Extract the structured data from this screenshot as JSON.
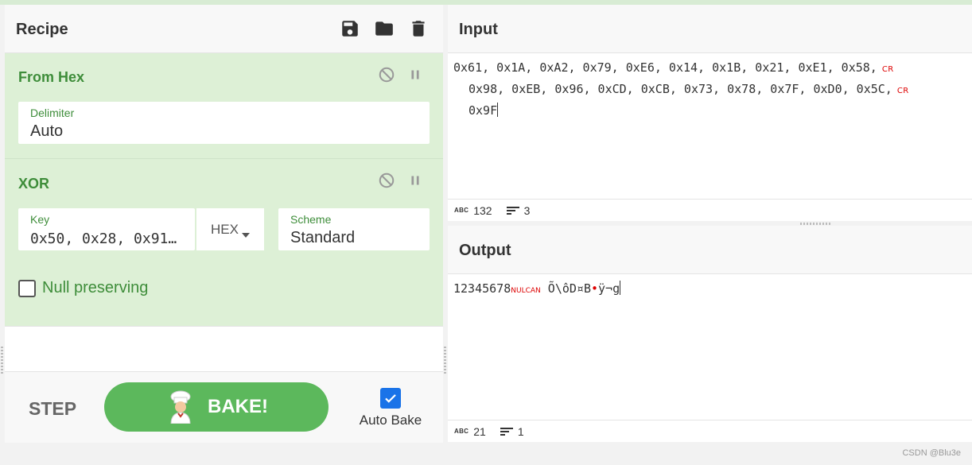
{
  "recipe": {
    "title": "Recipe",
    "icons": [
      "save-icon",
      "folder-icon",
      "trash-icon"
    ],
    "operations": [
      {
        "name": "From Hex",
        "fields": [
          {
            "label": "Delimiter",
            "value": "Auto"
          }
        ]
      },
      {
        "name": "XOR",
        "fields": [
          {
            "label": "Key",
            "value": "0x50, 0x28, 0x91…",
            "format": "HEX"
          },
          {
            "label": "Scheme",
            "value": "Standard"
          }
        ],
        "checkbox": {
          "label": "Null preserving",
          "checked": false
        }
      }
    ],
    "controls": {
      "step_label": "STEP",
      "bake_label": "BAKE!",
      "auto_bake_label": "Auto Bake",
      "auto_bake_checked": true
    }
  },
  "input": {
    "title": "Input",
    "lines": [
      "0x61, 0x1A, 0xA2, 0x79, 0xE6, 0x14, 0x1B, 0x21, 0xE1, 0x58,",
      "0x98, 0xEB, 0x96, 0xCD, 0xCB, 0x73, 0x78, 0x7F, 0xD0, 0x5C,",
      "0x9F"
    ],
    "cr_marker": "CR",
    "length": "132",
    "line_count": "3"
  },
  "output": {
    "title": "Output",
    "text_prefix": "12345678",
    "control_marker": "NULCAN",
    "text_middle": " Õ\\ôD¤B",
    "text_suffix": "ÿ¬g",
    "length": "21",
    "line_count": "1"
  },
  "watermark": "CSDN @Blu3e",
  "colors": {
    "accent_green": "#3e8d3a",
    "op_background": "#ddf0d6",
    "bake_button": "#5cb85c",
    "control_char": "#dd0000",
    "checkbox_blue": "#1a73e8"
  }
}
